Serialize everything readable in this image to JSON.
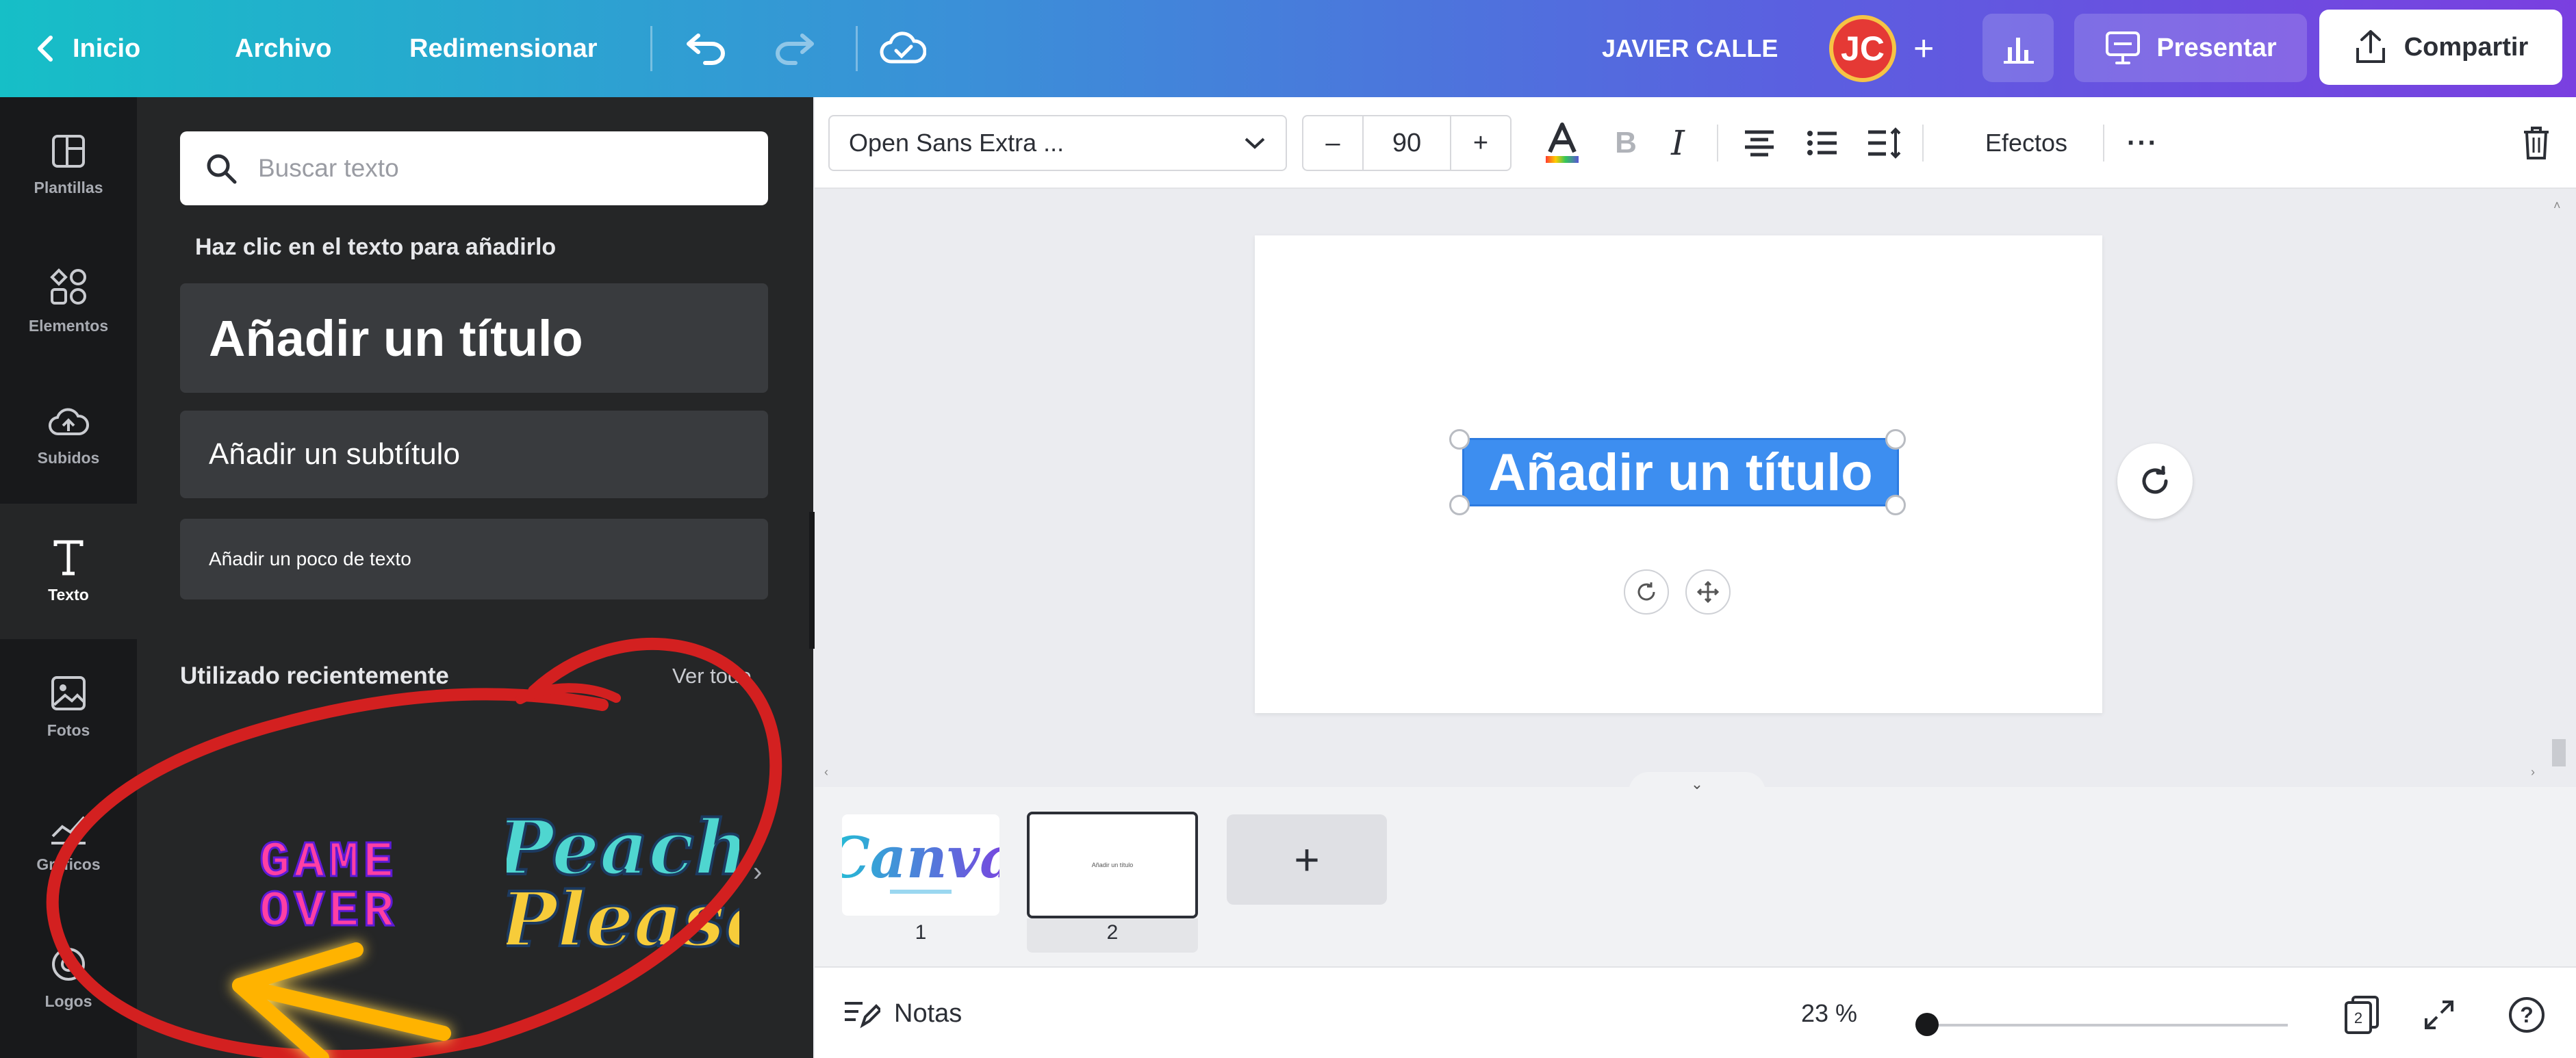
{
  "topbar": {
    "back_label": "Inicio",
    "file_label": "Archivo",
    "resize_label": "Redimensionar",
    "user_name": "JAVIER CALLE",
    "avatar_initials": "JC",
    "present_label": "Presentar",
    "share_label": "Compartir"
  },
  "rail": {
    "items": [
      {
        "label": "Plantillas",
        "icon": "template-icon"
      },
      {
        "label": "Elementos",
        "icon": "elements-icon"
      },
      {
        "label": "Subidos",
        "icon": "upload-cloud-icon"
      },
      {
        "label": "Texto",
        "icon": "text-icon"
      },
      {
        "label": "Fotos",
        "icon": "photo-icon"
      },
      {
        "label": "Gráficos",
        "icon": "chart-icon"
      },
      {
        "label": "Logos",
        "icon": "logo-icon"
      }
    ],
    "active": "Texto"
  },
  "panel": {
    "search_placeholder": "Buscar texto",
    "hint": "Haz clic en el texto para añadirlo",
    "heading_btn": "Añadir un título",
    "subheading_btn": "Añadir un subtítulo",
    "body_btn": "Añadir un poco de texto",
    "recent_title": "Utilizado recientemente",
    "see_all": "Ver todo",
    "recent_items": [
      {
        "text_line1": "GAME",
        "text_line2": "OVER"
      },
      {
        "text_line1": "Peach",
        "text_line2": "Please"
      }
    ]
  },
  "toolbar": {
    "font_name": "Open Sans Extra ...",
    "font_size": "90",
    "minus": "–",
    "plus": "+",
    "effects_label": "Efectos",
    "more": "···"
  },
  "canvas": {
    "selected_text": "Añadir un título"
  },
  "pages": {
    "items": [
      {
        "number": "1",
        "thumb_text": "Canva"
      },
      {
        "number": "2",
        "thumb_text": "Añadir un título"
      }
    ],
    "add": "+"
  },
  "bottom": {
    "notes_label": "Notas",
    "zoom": "23 %",
    "zoom_value_fraction": 0.0,
    "page_count": "2",
    "help": "?"
  },
  "colors": {
    "topbar_gradient_start": "#16bfc7",
    "topbar_gradient_end": "#7a3fe0",
    "panel_bg": "#252627",
    "selection": "#3d8ef0",
    "annotation_red": "#d32020",
    "annotation_arrow": "#ffb300"
  }
}
